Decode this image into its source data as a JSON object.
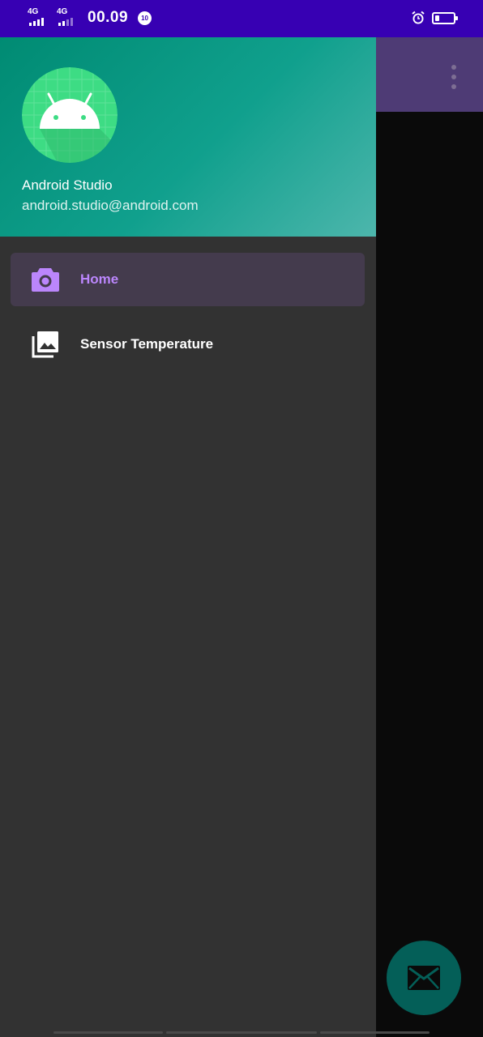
{
  "status_bar": {
    "network_1": "4G",
    "network_2": "4G",
    "time": "00.09",
    "notification_badge": "10",
    "icons": [
      "signal-icon",
      "signal-icon",
      "notification-icon",
      "alarm-icon",
      "battery-icon"
    ],
    "battery_level": 0.25
  },
  "app_bar": {
    "overflow_icon": "more-vert-icon",
    "color": "#4e3b75"
  },
  "drawer": {
    "header": {
      "user_name": "Android Studio",
      "user_email": "android.studio@android.com",
      "avatar_icon": "android-icon"
    },
    "items": [
      {
        "label": "Home",
        "icon": "camera-icon",
        "selected": true
      },
      {
        "label": "Sensor Temperature",
        "icon": "gallery-icon",
        "selected": false
      }
    ]
  },
  "fab": {
    "icon": "mail-icon"
  },
  "colors": {
    "status_bar": "#3700b3",
    "drawer_bg": "#323232",
    "accent": "#bb86fc",
    "header_start": "#008b73",
    "header_end": "#4db6ac",
    "fab": "#045f58"
  }
}
